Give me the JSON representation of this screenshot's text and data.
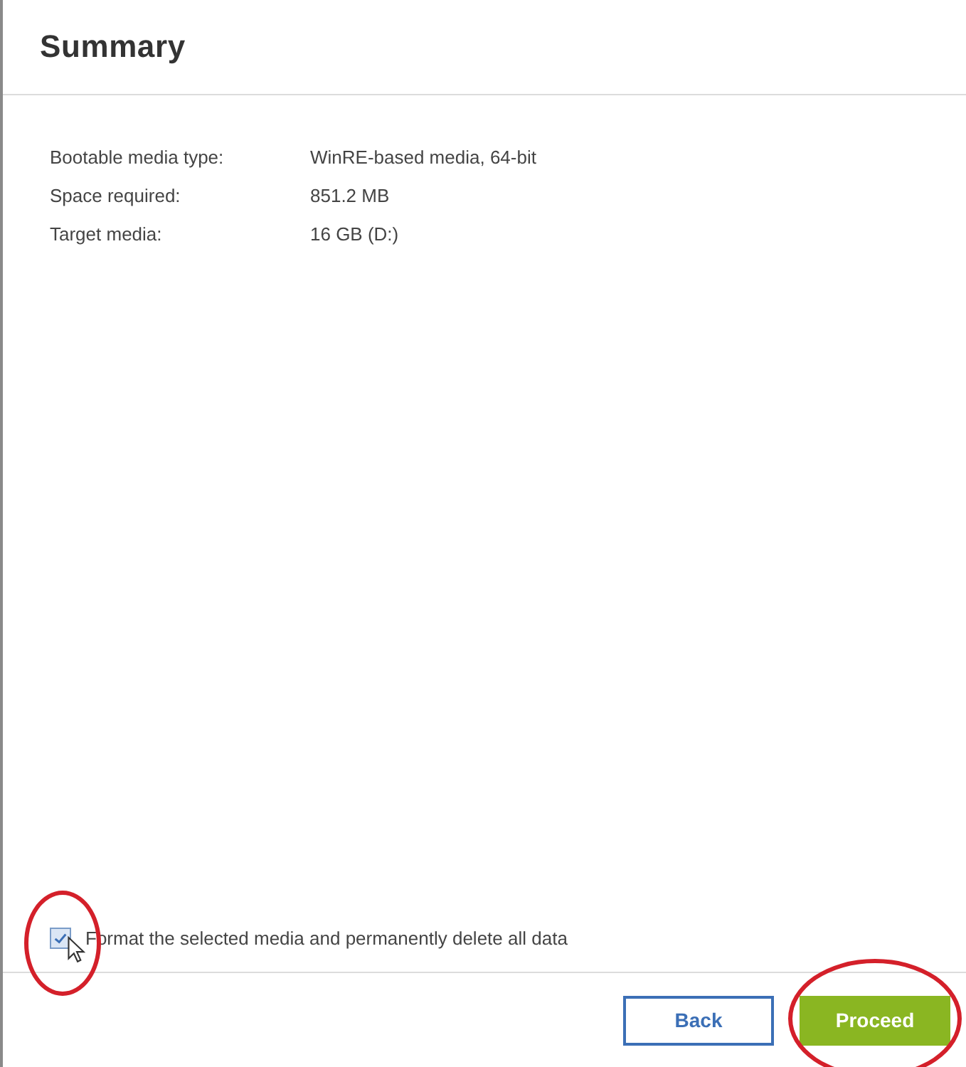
{
  "title": "Summary",
  "summary": [
    {
      "label": "Bootable media type:",
      "value": "WinRE-based media, 64-bit"
    },
    {
      "label": "Space required:",
      "value": "851.2 MB"
    },
    {
      "label": "Target media:",
      "value": "16 GB (D:)"
    }
  ],
  "format_option": {
    "label": "Format the selected media and permanently delete all data",
    "checked": true
  },
  "buttons": [
    {
      "label": "Back",
      "kind": "secondary"
    },
    {
      "label": "Proceed",
      "kind": "primary"
    }
  ]
}
